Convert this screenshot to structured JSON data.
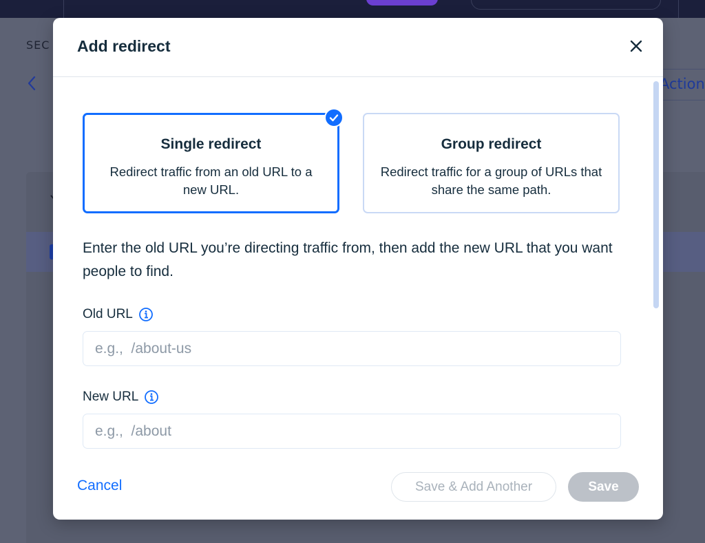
{
  "background": {
    "section_label": "SEC",
    "actions_label": "Action"
  },
  "modal": {
    "title": "Add redirect",
    "options": [
      {
        "title": "Single redirect",
        "description": "Redirect traffic from an old URL to a new URL.",
        "selected": true
      },
      {
        "title": "Group redirect",
        "description": "Redirect traffic for a group of URLs that share the same path.",
        "selected": false
      }
    ],
    "instructions": "Enter the old URL you’re directing traffic from, then add the new URL that you want people to find.",
    "old_url": {
      "label": "Old URL",
      "value": "",
      "placeholder": "e.g.,  /about-us"
    },
    "new_url": {
      "label": "New URL",
      "value": "",
      "placeholder": "e.g.,  /about"
    },
    "cancel_label": "Cancel",
    "save_add_another_label": "Save & Add Another",
    "save_label": "Save"
  },
  "colors": {
    "accent": "#116dff",
    "disabled_button": "#bcc1c8",
    "overlay": "#5d6274"
  },
  "icons": {
    "close": "close-icon",
    "check": "check-icon",
    "info": "info-icon",
    "back": "chevron-left-icon"
  }
}
